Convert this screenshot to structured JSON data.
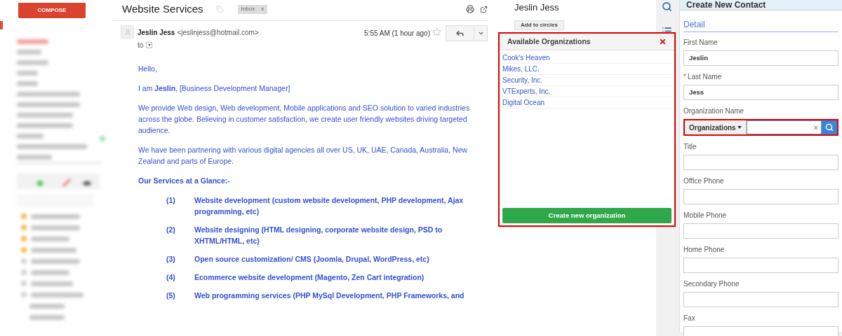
{
  "sidebar": {
    "compose": "COMPOSE"
  },
  "email": {
    "subject": "Website Services",
    "label": "Inbox",
    "label_remove": "x",
    "sender": "Jeslin Jess",
    "address": "<jeslinjess@hotmail.com>",
    "to": "to",
    "time": "5:55 AM (1 hour ago)",
    "starred": false,
    "body": [
      {
        "kind": "para",
        "text": "Hello,"
      },
      {
        "kind": "para",
        "text": "I am **Jeslin**, [Business Development Manager]"
      },
      {
        "kind": "para",
        "text": "We provide Web design, Web development, Mobile applications and SEO solution to varied industries across the globe. Believing in customer satisfaction, we create user friendly websites driving targeted audience."
      },
      {
        "kind": "para",
        "text": "We have been partnering with various digital agencies all over US, UK, UAE, Canada, Australia, New Zealand and parts of Europe."
      },
      {
        "kind": "heading",
        "text": "Our Services at a Glance:-"
      },
      {
        "kind": "item",
        "num": "(1)",
        "text": "Website development (custom website development, PHP development, Ajax programming, etc)"
      },
      {
        "kind": "item",
        "num": "(2)",
        "text": "Website designing (HTML designing, corporate website design, PSD to XHTML/HTML, etc)"
      },
      {
        "kind": "item",
        "num": "(3)",
        "text": "Open source customization/ CMS (Joomla, Drupal, WordPress, etc)"
      },
      {
        "kind": "item",
        "num": "(4)",
        "text": "Ecommerce website development (Magento, Zen Cart integration)"
      },
      {
        "kind": "item",
        "num": "(5)",
        "text": "Web programming services (PHP MySql Development, PHP Frameworks, and"
      }
    ]
  },
  "contact_card": {
    "name": "Jeslin Jess",
    "button": "Add to circles"
  },
  "popup": {
    "title": "Available Organizations",
    "items": [
      "Cook's Heaven",
      "Mikes, LLC.",
      "Security, Inc.",
      "VTExperts, Inc.",
      "Digital Ocean"
    ],
    "button": "Create new organization"
  },
  "panel": {
    "title": "Create New Contact",
    "section": "Detail",
    "required_mark": "*",
    "fields": [
      {
        "kind": "text",
        "label": "First Name",
        "value": "Jeslin",
        "required": false
      },
      {
        "kind": "text",
        "label": "Last Name",
        "value": "Jess",
        "required": true
      },
      {
        "kind": "organization",
        "label": "Organization Name",
        "dropdown": "Organizations",
        "clear": "×",
        "required": false
      },
      {
        "kind": "text",
        "label": "Title",
        "required": false
      },
      {
        "kind": "text",
        "label": "Office Phone",
        "required": false
      },
      {
        "kind": "text",
        "label": "Mobile Phone",
        "required": false
      },
      {
        "kind": "text",
        "label": "Home Phone",
        "required": false
      },
      {
        "kind": "text",
        "label": "Secondary Phone",
        "required": false
      },
      {
        "kind": "text",
        "label": "Fax",
        "required": false
      }
    ]
  }
}
